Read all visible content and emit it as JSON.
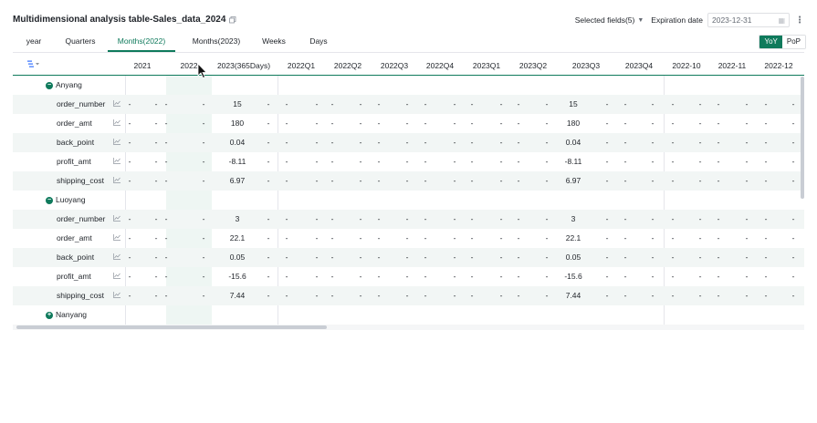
{
  "title": "Multidimensional analysis table-Sales_data_2024",
  "toolbar": {
    "selected_fields": "Selected fields(5)",
    "expiration_label": "Expiration date",
    "expiration_value": "2023-12-31"
  },
  "tabs": [
    {
      "label": "year"
    },
    {
      "label": "Quarters"
    },
    {
      "label": "Months(2022)"
    },
    {
      "label": "Months(2023)"
    },
    {
      "label": "Weeks"
    },
    {
      "label": "Days"
    }
  ],
  "active_tab": "Months(2022)",
  "compare": {
    "yoy": "YoY",
    "pop": "PoP"
  },
  "columns": [
    "2021",
    "2022",
    "2023(365Days)",
    "2022Q1",
    "2022Q2",
    "2022Q3",
    "2022Q4",
    "2023Q1",
    "2023Q2",
    "2023Q3",
    "2023Q4",
    "2022-10",
    "2022-11",
    "2022-12"
  ],
  "groups": [
    {
      "name": "Anyang",
      "expanded": true,
      "metrics": [
        {
          "name": "order_number",
          "v2023": "15",
          "q3": "15"
        },
        {
          "name": "order_amt",
          "v2023": "180",
          "q3": "180"
        },
        {
          "name": "back_point",
          "v2023": "0.04",
          "q3": "0.04"
        },
        {
          "name": "profit_amt",
          "v2023": "-8.11",
          "q3": "-8.11"
        },
        {
          "name": "shipping_cost",
          "v2023": "6.97",
          "q3": "6.97"
        }
      ]
    },
    {
      "name": "Luoyang",
      "expanded": true,
      "metrics": [
        {
          "name": "order_number",
          "v2023": "3",
          "q3": "3"
        },
        {
          "name": "order_amt",
          "v2023": "22.1",
          "q3": "22.1"
        },
        {
          "name": "back_point",
          "v2023": "0.05",
          "q3": "0.05"
        },
        {
          "name": "profit_amt",
          "v2023": "-15.6",
          "q3": "-15.6"
        },
        {
          "name": "shipping_cost",
          "v2023": "7.44",
          "q3": "7.44"
        }
      ]
    },
    {
      "name": "Nanyang",
      "expanded": false,
      "metrics": []
    }
  ],
  "empty_value": "-",
  "colors": {
    "accent": "#0f7a5c",
    "row_alt": "#f2f6f5"
  }
}
